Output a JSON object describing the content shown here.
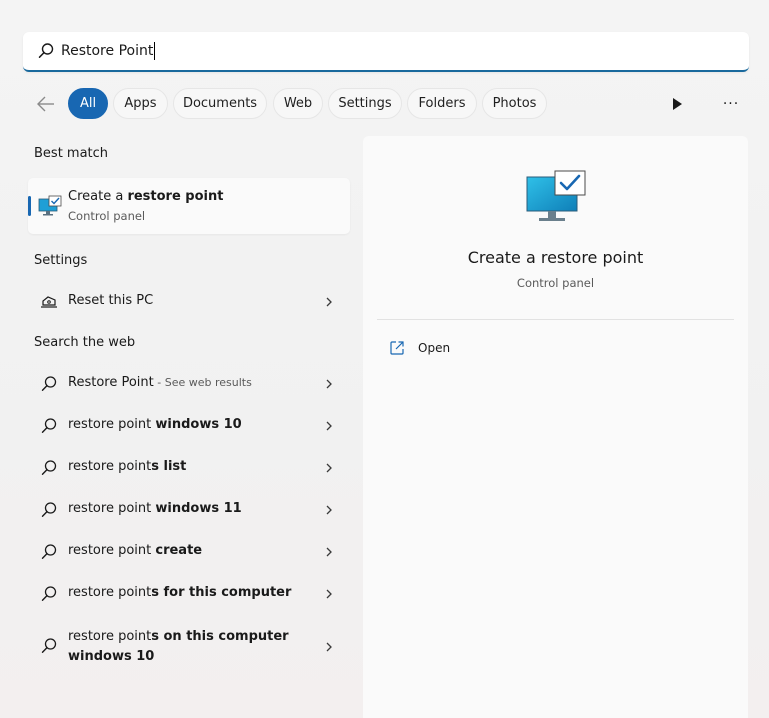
{
  "search": {
    "value": "Restore Point",
    "icon": "search-icon"
  },
  "filters": {
    "back_icon": "back-arrow-icon",
    "tabs": [
      {
        "label": "All",
        "active": true
      },
      {
        "label": "Apps",
        "active": false
      },
      {
        "label": "Documents",
        "active": false
      },
      {
        "label": "Web",
        "active": false
      },
      {
        "label": "Settings",
        "active": false
      },
      {
        "label": "Folders",
        "active": false
      },
      {
        "label": "Photos",
        "active": false
      }
    ],
    "play_icon": "play-icon",
    "more_label": "···"
  },
  "best_match": {
    "heading": "Best match",
    "title_pre": "Create a ",
    "title_bold": "restore point",
    "subtitle": "Control panel",
    "icon": "system-restore-icon"
  },
  "settings": {
    "heading": "Settings",
    "items": [
      {
        "label": "Reset this PC",
        "icon": "reset-pc-icon"
      }
    ]
  },
  "web": {
    "heading": "Search the web",
    "items": [
      {
        "pre": "Restore Point",
        "bold": "",
        "hint": " - See web results"
      },
      {
        "pre": "restore point ",
        "bold": "windows 10",
        "hint": ""
      },
      {
        "pre": "restore point",
        "bold": "s list",
        "hint": ""
      },
      {
        "pre": "restore point ",
        "bold": "windows 11",
        "hint": ""
      },
      {
        "pre": "restore point ",
        "bold": "create",
        "hint": ""
      },
      {
        "pre": "restore point",
        "bold": "s for this computer",
        "hint": ""
      },
      {
        "pre": "restore point",
        "bold": "s on this computer windows 10",
        "hint": ""
      }
    ]
  },
  "preview": {
    "title": "Create a restore point",
    "subtitle": "Control panel",
    "actions": [
      {
        "label": "Open",
        "icon": "open-external-icon"
      }
    ]
  },
  "colors": {
    "accent": "#1867b2",
    "search_underline": "#19699d"
  }
}
